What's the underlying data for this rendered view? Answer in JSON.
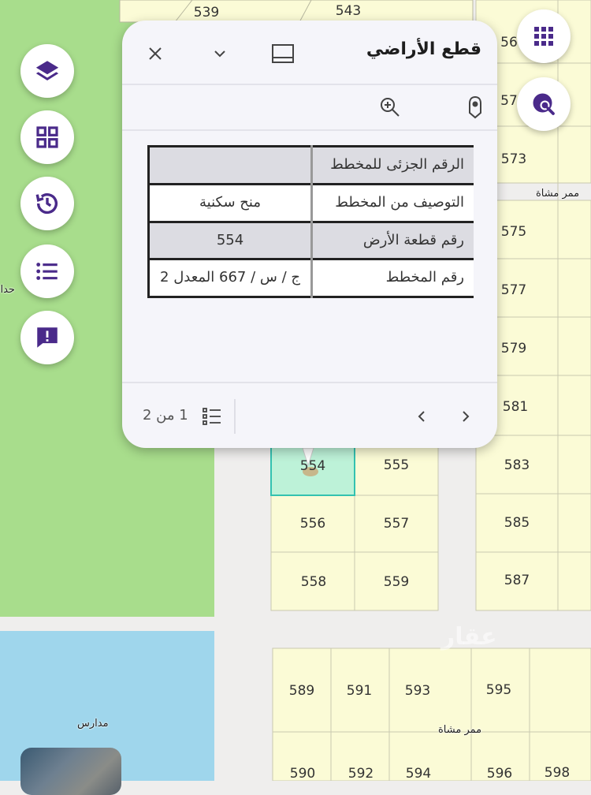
{
  "map": {
    "lot_labels": [
      {
        "id": "539",
        "text": "539"
      },
      {
        "id": "543",
        "text": "543"
      },
      {
        "id": "561",
        "text": "56"
      },
      {
        "id": "571",
        "text": "57"
      },
      {
        "id": "573",
        "text": "573"
      },
      {
        "id": "575",
        "text": "575"
      },
      {
        "id": "577",
        "text": "577"
      },
      {
        "id": "579",
        "text": "579"
      },
      {
        "id": "581",
        "text": "581"
      },
      {
        "id": "583",
        "text": "583"
      },
      {
        "id": "585",
        "text": "585"
      },
      {
        "id": "587",
        "text": "587"
      },
      {
        "id": "554",
        "text": "554"
      },
      {
        "id": "555",
        "text": "555"
      },
      {
        "id": "556",
        "text": "556"
      },
      {
        "id": "557",
        "text": "557"
      },
      {
        "id": "558",
        "text": "558"
      },
      {
        "id": "559",
        "text": "559"
      },
      {
        "id": "589",
        "text": "589"
      },
      {
        "id": "591",
        "text": "591"
      },
      {
        "id": "593",
        "text": "593"
      },
      {
        "id": "595",
        "text": "595"
      },
      {
        "id": "590",
        "text": "590"
      },
      {
        "id": "592",
        "text": "592"
      },
      {
        "id": "594",
        "text": "594"
      },
      {
        "id": "596",
        "text": "596"
      },
      {
        "id": "598",
        "text": "598"
      }
    ],
    "place_labels": {
      "walkway_1": "ممر مشاة",
      "walkway_2": "ممر مشاة",
      "park": "حدائق",
      "schools": "مدارس"
    },
    "colors": {
      "parcel": "#fbfbd6",
      "selected_parcel": "#bdf2d8",
      "park": "#a8dd8c",
      "water": "#9fd6ec",
      "road": "#efeeed",
      "accent": "#4a2a8a"
    }
  },
  "left_toolbar": {
    "buttons": [
      {
        "name": "layers",
        "icon": "layers-icon"
      },
      {
        "name": "basemap-gallery",
        "icon": "grid-icon"
      },
      {
        "name": "history",
        "icon": "history-icon"
      },
      {
        "name": "legend-list",
        "icon": "list-icon"
      },
      {
        "name": "feedback",
        "icon": "feedback-icon"
      }
    ]
  },
  "right_toolbar": {
    "buttons": [
      {
        "name": "apps",
        "icon": "apps-grid-icon"
      },
      {
        "name": "search-location",
        "icon": "globe-search-icon"
      }
    ]
  },
  "popup": {
    "title": "قطع الأراضي",
    "table": [
      {
        "key": "الرقم الجزئى للمخطط",
        "value": ""
      },
      {
        "key": "التوصيف من المخطط",
        "value": "منح سكنية"
      },
      {
        "key": "رقم قطعة الأرض",
        "value": "554"
      },
      {
        "key": "رقم المخطط",
        "value": "ج / س / 667 المعدل 2"
      }
    ],
    "pager": "1 من 2"
  }
}
